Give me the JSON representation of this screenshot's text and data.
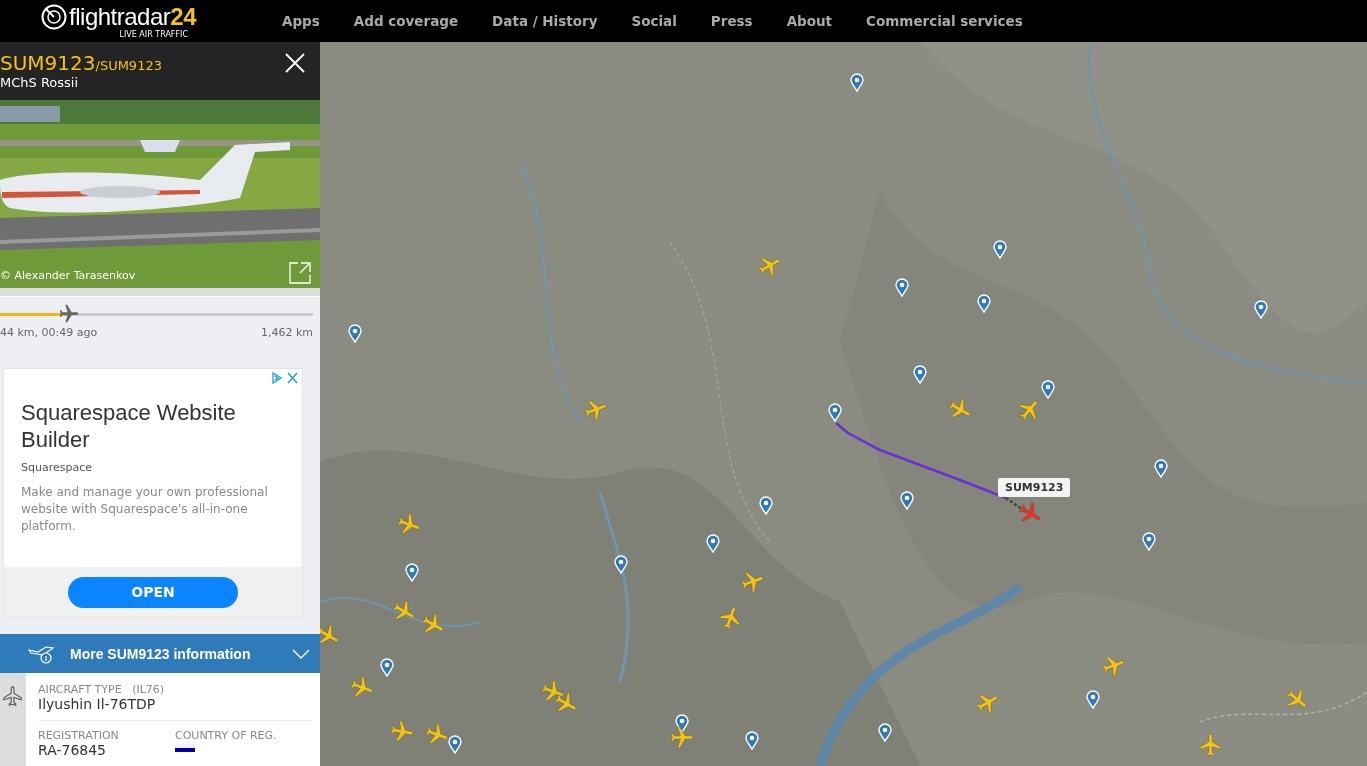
{
  "header": {
    "logo_text": "flightradar",
    "logo_number": "24",
    "tagline": "LIVE AIR TRAFFIC",
    "nav": [
      {
        "label": "Apps"
      },
      {
        "label": "Add coverage"
      },
      {
        "label": "Data / History"
      },
      {
        "label": "Social"
      },
      {
        "label": "Press"
      },
      {
        "label": "About"
      },
      {
        "label": "Commercial services"
      }
    ]
  },
  "flight_panel": {
    "callsign": "SUM9123",
    "alt_callsign": "/SUM9123",
    "airline": "MChS Rossii",
    "photo_credit": "© Alexander Tarasenkov",
    "progress": {
      "level": 0.22,
      "elapsed": "44 km, 00:49 ago",
      "remaining": "1,462 km"
    }
  },
  "ad": {
    "title": "Squarespace Website Builder",
    "advertiser": "Squarespace",
    "body": "Make and manage your own professional website with Squarespace's all-in-one platform.",
    "button": "OPEN"
  },
  "info_bar": {
    "label": "More SUM9123 information",
    "expanded": false
  },
  "aircraft_type": {
    "label": "AIRCRAFT TYPE",
    "code": "(IL76)",
    "value": "Ilyushin Il-76TDP"
  },
  "registration": {
    "label": "REGISTRATION",
    "value": "RA-76845"
  },
  "country": {
    "label": "COUNTRY OF REG."
  },
  "map": {
    "flight_tag": "SUM9123"
  }
}
